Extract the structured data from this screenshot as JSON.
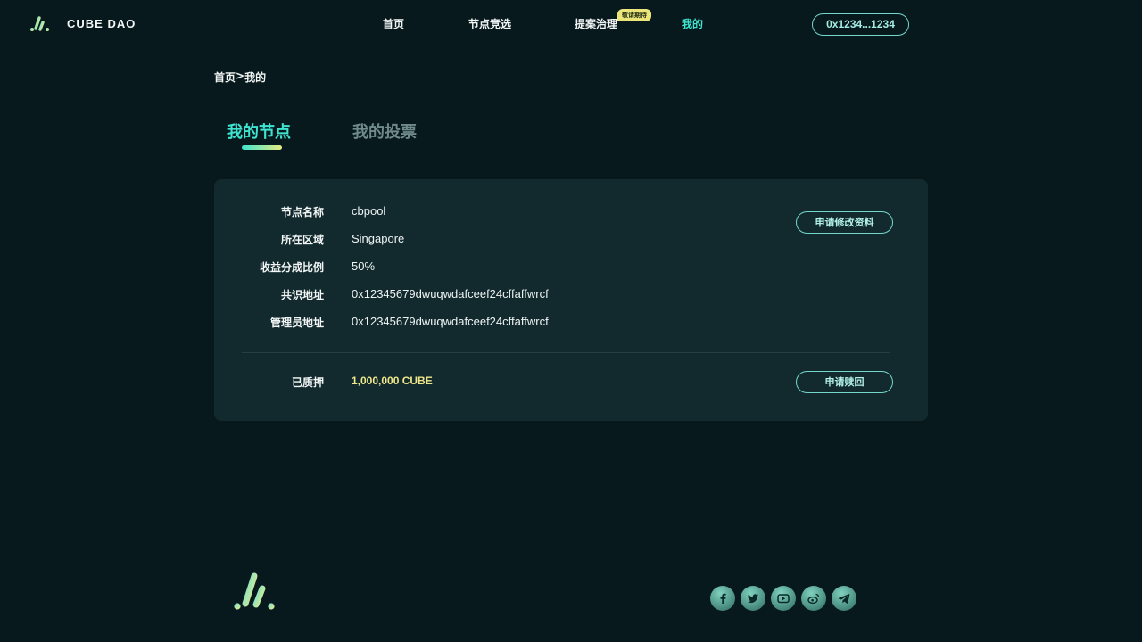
{
  "header": {
    "brand": "CUBE DAO",
    "nav": [
      {
        "label": "首页"
      },
      {
        "label": "节点竞选"
      },
      {
        "label": "提案治理",
        "badge": "敬请期待"
      },
      {
        "label": "我的"
      }
    ],
    "wallet": "0x1234...1234"
  },
  "breadcrumb": {
    "home": "首页",
    "separator": ">",
    "current": "我的"
  },
  "tabs": [
    {
      "label": "我的节点",
      "active": true
    },
    {
      "label": "我的投票",
      "active": false
    }
  ],
  "node": {
    "fields": [
      {
        "label": "节点名称",
        "value": "cbpool"
      },
      {
        "label": "所在区域",
        "value": "Singapore"
      },
      {
        "label": "收益分成比例",
        "value": "50%"
      },
      {
        "label": "共识地址",
        "value": "0x12345679dwuqwdafceef24cffaffwrcf"
      },
      {
        "label": "管理员地址",
        "value": "0x12345679dwuqwdafceef24cffaffwrcf"
      }
    ],
    "edit_button": "申请修改资料",
    "stake": {
      "label": "已质押",
      "value": "1,000,000 CUBE"
    },
    "redeem_button": "申请赎回"
  },
  "footer": {
    "socials": [
      "facebook-icon",
      "twitter-icon",
      "youtube-icon",
      "weibo-icon",
      "telegram-icon"
    ]
  },
  "colors": {
    "accent": "#3ee4cf",
    "stake": "#eee88a",
    "background": "#07191c",
    "card": "#122a2e"
  }
}
